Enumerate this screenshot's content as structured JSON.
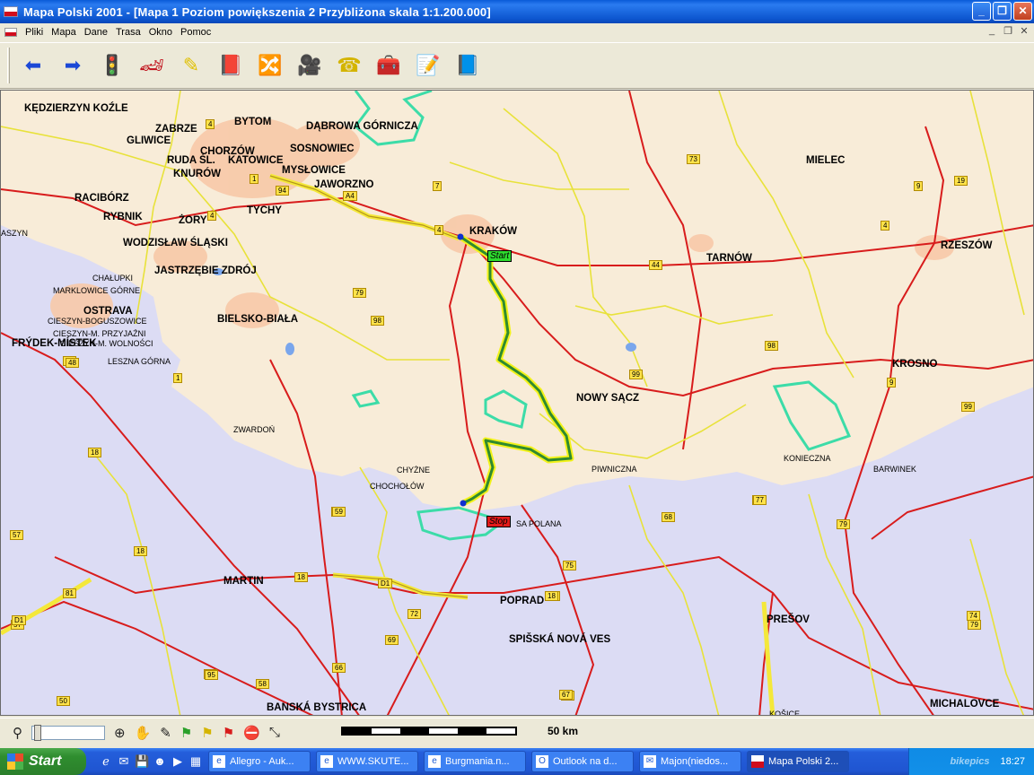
{
  "window": {
    "title": "Mapa Polski 2001 - [Mapa 1 Poziom powiększenia 2 Przybliżona skala 1:1.200.000]",
    "buttons": [
      "_",
      "❐",
      "✕"
    ]
  },
  "menu": {
    "items": [
      "Pliki",
      "Mapa",
      "Dane",
      "Trasa",
      "Okno",
      "Pomoc"
    ],
    "mdi_buttons": [
      "_",
      "❐",
      "✕"
    ]
  },
  "toolbar": {
    "buttons": [
      {
        "name": "back-arrow-icon",
        "glyph": "⬅",
        "color": "#1b48d6"
      },
      {
        "name": "forward-arrow-icon",
        "glyph": "➡",
        "color": "#1b48d6"
      },
      {
        "name": "traffic-light-icon",
        "glyph": "🚦",
        "color": "#1d3fa8"
      },
      {
        "name": "race-car-icon",
        "glyph": "🏎",
        "color": "#c0101a"
      },
      {
        "name": "eraser-icon",
        "glyph": "✎",
        "color": "#e0c000"
      },
      {
        "name": "red-book-icon",
        "glyph": "📕",
        "color": "#c0101a"
      },
      {
        "name": "route-sign-icon",
        "glyph": "🔀",
        "color": "#1d3fa8"
      },
      {
        "name": "camera-icon",
        "glyph": "🎥",
        "color": "#b01010"
      },
      {
        "name": "telephone-icon",
        "glyph": "☎",
        "color": "#d4b400"
      },
      {
        "name": "first-aid-icon",
        "glyph": "🧰",
        "color": "#c0101a"
      },
      {
        "name": "info-document-icon",
        "glyph": "📝",
        "color": "#2a8a8a"
      },
      {
        "name": "help-book-icon",
        "glyph": "📘",
        "color": "#6a2aa0"
      }
    ]
  },
  "map": {
    "cities": [
      {
        "label": "KĘDZIERZYN KOŹLE",
        "cls": "city"
      },
      {
        "label": "BYTOM",
        "cls": "city"
      },
      {
        "label": "ZABRZE",
        "cls": "city"
      },
      {
        "label": "DĄBROWA GÓRNICZA",
        "cls": "city"
      },
      {
        "label": "GLIWICE",
        "cls": "city"
      },
      {
        "label": "CHORZÓW",
        "cls": "city"
      },
      {
        "label": "SOSNOWIEC",
        "cls": "city"
      },
      {
        "label": "RUDA ŚL.",
        "cls": "city"
      },
      {
        "label": "KATOWICE",
        "cls": "city"
      },
      {
        "label": "MYSŁOWICE",
        "cls": "city"
      },
      {
        "label": "KNURÓW",
        "cls": "city"
      },
      {
        "label": "JAWORZNO",
        "cls": "city"
      },
      {
        "label": "MIELEC",
        "cls": "city"
      },
      {
        "label": "RACIBÓRZ",
        "cls": "city"
      },
      {
        "label": "TYCHY",
        "cls": "city"
      },
      {
        "label": "RYBNIK",
        "cls": "city"
      },
      {
        "label": "ŻORY",
        "cls": "city"
      },
      {
        "label": "KRAKÓW",
        "cls": "city"
      },
      {
        "label": "RZESZÓW",
        "cls": "city"
      },
      {
        "label": "WODZISŁAW ŚLĄSKI",
        "cls": "city"
      },
      {
        "label": "TARNÓW",
        "cls": "city"
      },
      {
        "label": "JASTRZĘBIE ZDRÓJ",
        "cls": "city"
      },
      {
        "label": "OSTRAVA",
        "cls": "city"
      },
      {
        "label": "BIELSKO-BIAŁA",
        "cls": "city"
      },
      {
        "label": "FRÝDEK-MÍSTEK",
        "cls": "city"
      },
      {
        "label": "KROSNO",
        "cls": "city"
      },
      {
        "label": "NOWY SĄCZ",
        "cls": "city"
      },
      {
        "label": "MARTIN",
        "cls": "city"
      },
      {
        "label": "POPRAD",
        "cls": "city"
      },
      {
        "label": "PREŠOV",
        "cls": "city"
      },
      {
        "label": "SPIŠSKÁ NOVÁ VES",
        "cls": "city"
      },
      {
        "label": "BANSKÁ BYSTRICA",
        "cls": "city"
      },
      {
        "label": "MICHALOVCE",
        "cls": "city"
      }
    ],
    "towns": [
      "ASZYN",
      "CHAŁUPKI",
      "MARKLOWICE GÓRNE",
      "CIESZYN-BOGUSZOWICE",
      "CIESZYN-M. PRZYJAŹNI",
      "CIESZYN-M. WOLNOŚCI",
      "LESZNA GÓRNA",
      "ZWARDOŃ",
      "CHYŻNE",
      "CHOCHOŁÓW",
      "PIWNICZNA",
      "KONIECZNA",
      "BARWINEK",
      "SA POLANA",
      "KOŠICE"
    ],
    "road_numbers": [
      "4",
      "73",
      "19",
      "9",
      "4",
      "44",
      "A4",
      "1",
      "94",
      "7",
      "4",
      "4",
      "79",
      "98",
      "99",
      "99",
      "98",
      "9",
      "40",
      "1",
      "81",
      "48",
      "18",
      "18",
      "29",
      "69",
      "75",
      "77",
      "79",
      "68",
      "57",
      "57",
      "18",
      "D1",
      "18",
      "D1",
      "72",
      "18",
      "73",
      "74",
      "65",
      "66",
      "58",
      "67",
      "59",
      "50",
      "79",
      "77",
      "95",
      "95"
    ],
    "markers": {
      "start": "Start",
      "stop": "Stop"
    },
    "colors": {
      "poland_land": "#f8ecd8",
      "foreign_land": "#dcdcf4",
      "route": "#2f8a2f",
      "route_glow": "#f2f21a",
      "national_park": "#3cdca8"
    }
  },
  "statusbar": {
    "scale_label": "50 km",
    "icons": [
      "zoom-out-icon",
      "zoom-in-icon",
      "hand-icon",
      "pin-icon",
      "green-flag-icon",
      "yellow-flag-icon",
      "red-flag-icon",
      "stop-sign-icon",
      "measure-icon"
    ]
  },
  "taskbar": {
    "start_label": "Start",
    "tasks": [
      {
        "label": "Allegro - Auk..."
      },
      {
        "label": "WWW.SKUTE..."
      },
      {
        "label": "Burgmania.n..."
      },
      {
        "label": "Outlook na d..."
      },
      {
        "label": "Majon(niedos..."
      },
      {
        "label": "Mapa Polski 2..."
      }
    ],
    "clock": "18:27",
    "watermark": "bikepics"
  }
}
